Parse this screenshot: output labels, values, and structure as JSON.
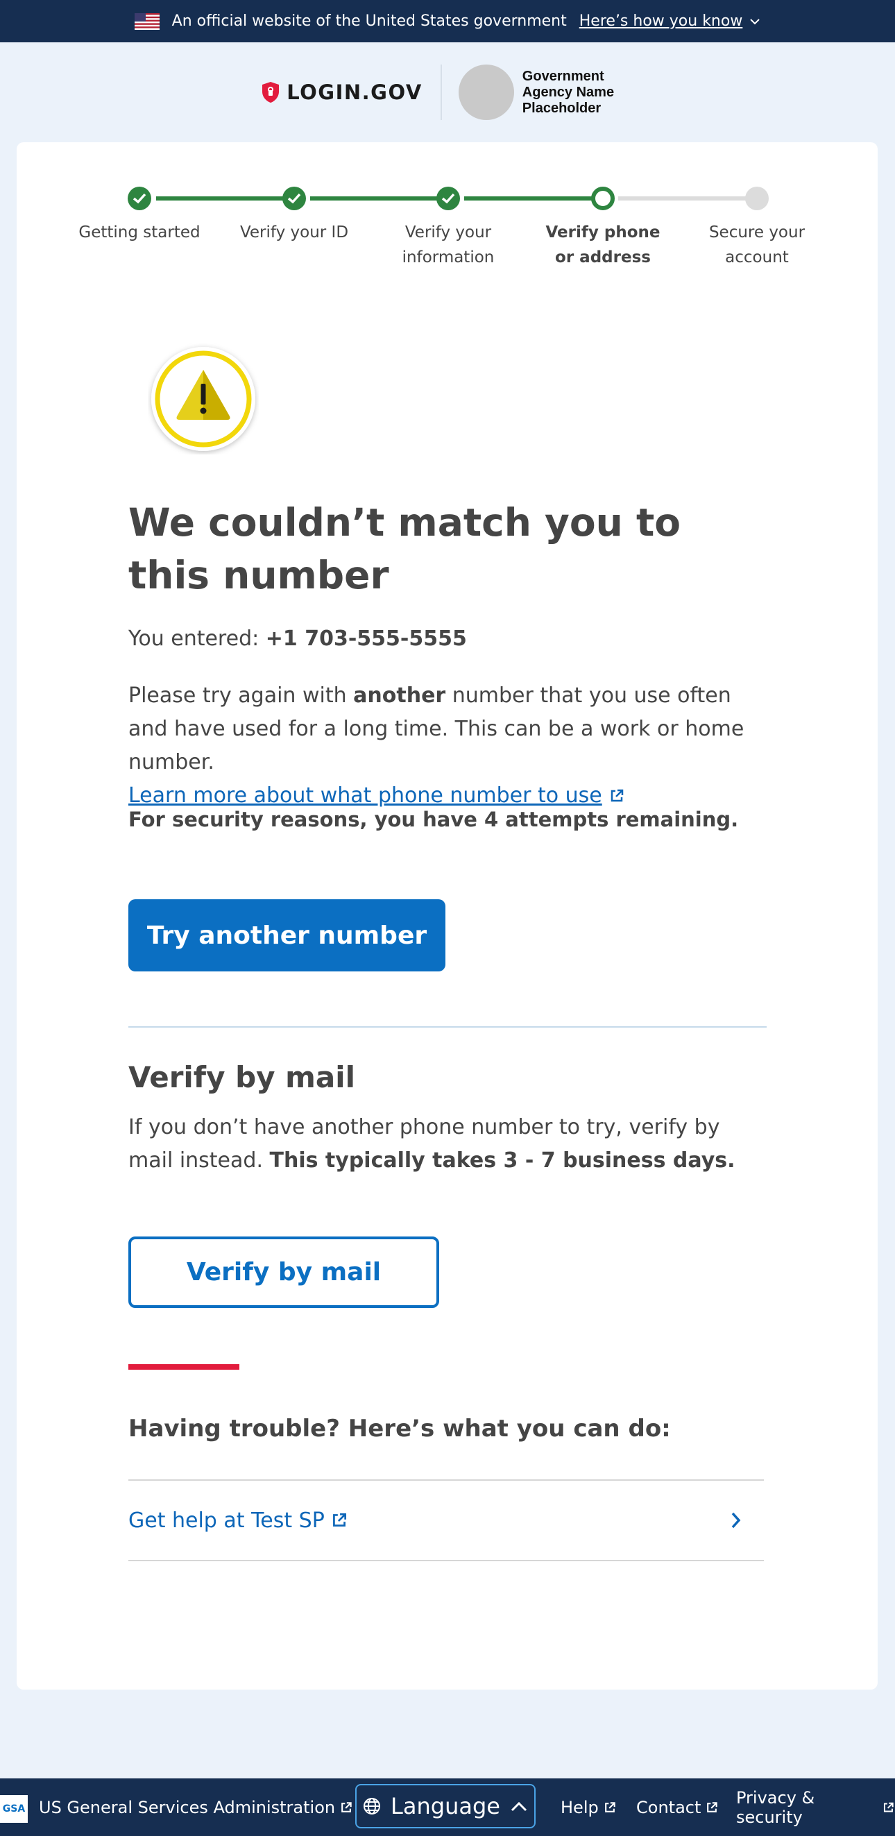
{
  "gov_banner": {
    "text": "An official website of the United States government",
    "link": "Here’s how you know"
  },
  "header": {
    "logo_text": "LOGIN.GOV",
    "agency_name": "Government Agency Name Placeholder"
  },
  "steps": [
    {
      "label": "Getting started",
      "status": "complete"
    },
    {
      "label": "Verify your ID",
      "status": "complete"
    },
    {
      "label": "Verify your information",
      "status": "complete"
    },
    {
      "label": "Verify phone or address",
      "status": "current"
    },
    {
      "label": "Secure your account",
      "status": "incomplete"
    }
  ],
  "main": {
    "heading": "We couldn’t match you to this number",
    "entered_label": "You entered:",
    "entered_value": "+1 703-555-5555",
    "desc_1": "Please try again with ",
    "desc_bold": "another",
    "desc_2": " number that you use often and have used for a long time. This can be a work or home number.",
    "learn_more": "Learn more about what phone number to use",
    "attempts": "For security reasons, you have 4 attempts remaining.",
    "try_button": "Try another number"
  },
  "mail": {
    "heading": "Verify by mail",
    "desc": "If you don’t have another phone number to try, verify by mail instead. ",
    "desc_bold": "This typically takes 3 - 7 business days.",
    "button": "Verify by mail"
  },
  "trouble": {
    "heading": "Having trouble? Here’s what you can do:",
    "help_link": "Get help at Test SP"
  },
  "footer": {
    "gsa_logo": "GSA",
    "gsa": "US General Services Administration",
    "language": "Language",
    "help": "Help",
    "contact": "Contact",
    "privacy": "Privacy & security"
  },
  "colors": {
    "banner_bg": "#162e51",
    "page_bg": "#ebf2fa",
    "success": "#2e8540",
    "primary": "#0b6fc2",
    "accent_red": "#e21c3d",
    "warning": "#e5cf1b"
  }
}
